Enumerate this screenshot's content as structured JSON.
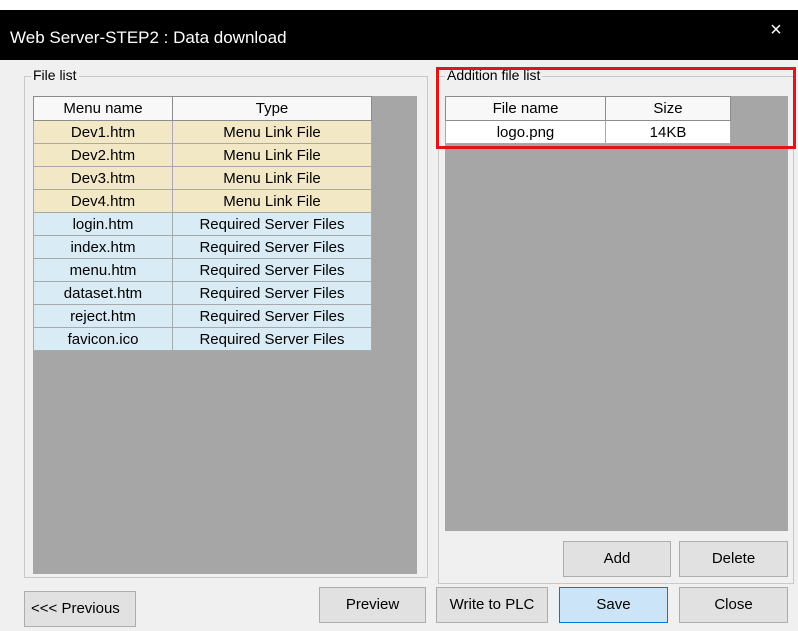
{
  "window": {
    "title": "Web Server-STEP2 : Data download",
    "close_glyph": "×"
  },
  "file_list": {
    "label": "File list",
    "columns": [
      "Menu name",
      "Type"
    ],
    "rows": [
      {
        "name": "Dev1.htm",
        "type": "Menu Link File",
        "kind": "menu"
      },
      {
        "name": "Dev2.htm",
        "type": "Menu Link File",
        "kind": "menu"
      },
      {
        "name": "Dev3.htm",
        "type": "Menu Link File",
        "kind": "menu"
      },
      {
        "name": "Dev4.htm",
        "type": "Menu Link File",
        "kind": "menu"
      },
      {
        "name": "login.htm",
        "type": "Required Server Files",
        "kind": "req"
      },
      {
        "name": "index.htm",
        "type": "Required Server Files",
        "kind": "req"
      },
      {
        "name": "menu.htm",
        "type": "Required Server Files",
        "kind": "req"
      },
      {
        "name": "dataset.htm",
        "type": "Required Server Files",
        "kind": "req"
      },
      {
        "name": "reject.htm",
        "type": "Required Server Files",
        "kind": "req"
      },
      {
        "name": "favicon.ico",
        "type": "Required Server Files",
        "kind": "req"
      }
    ]
  },
  "addition_list": {
    "label": "Addition file list",
    "columns": [
      "File name",
      "Size"
    ],
    "rows": [
      {
        "name": "logo.png",
        "size": "14KB"
      }
    ]
  },
  "buttons": {
    "add": "Add",
    "delete": "Delete",
    "previous": "<<< Previous",
    "preview": "Preview",
    "write_plc": "Write to PLC",
    "save": "Save",
    "close": "Close"
  },
  "colors": {
    "menu_row": "#f3e8c6",
    "required_row": "#d9ebf5",
    "highlight": "#e0151c",
    "primary_button": "#cce4f7"
  }
}
